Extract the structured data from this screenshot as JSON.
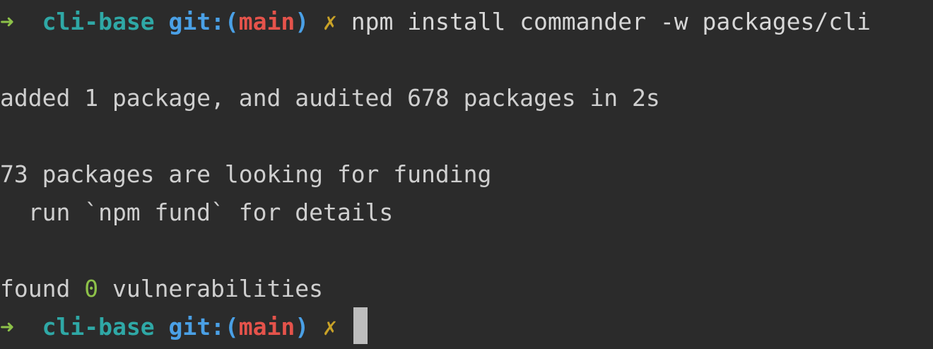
{
  "prompt": {
    "arrow": "➜",
    "directory": "cli-base",
    "git_prefix": "git:(",
    "branch": "main",
    "git_suffix": ")",
    "dirty_mark": "✗"
  },
  "command": "npm install commander -w packages/cli",
  "output": {
    "added": "added 1 package, and audited 678 packages in 2s",
    "funding": "73 packages are looking for funding",
    "fund_hint": "  run `npm fund` for details",
    "found_prefix": "found ",
    "vuln_count": "0",
    "found_suffix": " vulnerabilities"
  },
  "colors": {
    "background": "#2b2b2b",
    "arrow": "#8dc149",
    "directory": "#2fa8a6",
    "git": "#4aa0e6",
    "branch": "#e5534b",
    "dirty": "#c9a227"
  }
}
